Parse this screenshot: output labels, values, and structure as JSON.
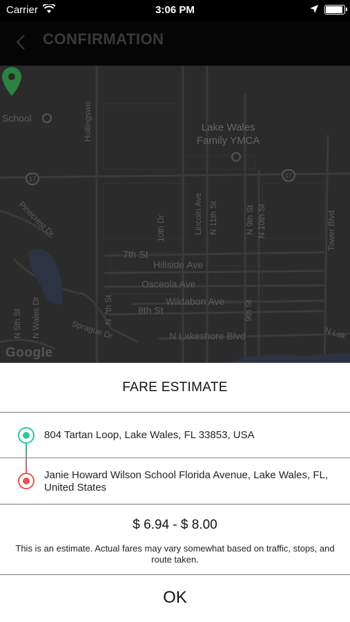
{
  "status_bar": {
    "carrier": "Carrier",
    "time": "3:06 PM",
    "battery_level": 0.95
  },
  "nav": {
    "title": "CONFIRMATION"
  },
  "map": {
    "labels": {
      "school": "School",
      "ymca": "Lake Wales\nFamily YMCA",
      "hollingsworth": "Hollingswo",
      "n10th": "N 10th St",
      "n9th_top": "N 9th St",
      "lincoln": "Lincoln Ave",
      "n11th": "N 11th St",
      "tower": "Tower Blvd",
      "tenth_dr": "10th Dr",
      "pinecrest": "Pinecrest Dr",
      "seventh": "7th St",
      "hillside": "Hillside Ave",
      "osceola": "Osceola Ave",
      "eighth": "8th St",
      "wildabon": "Wildabon Ave",
      "n7th": "N 7th St",
      "ninth": "9th St",
      "n5th": "N 5th St",
      "n_wales": "N Wales Dr",
      "sprague": "Sprague Dr",
      "lakeshore": "N Lakeshore Blvd",
      "n_lake": "N Lak",
      "route_17": "17",
      "google": "Google"
    },
    "accent_pin": "#2e9e4a"
  },
  "fare_sheet": {
    "title": "FARE ESTIMATE",
    "pickup": "804 Tartan Loop, Lake Wales, FL 33853, USA",
    "dropoff": "Janie Howard Wilson School Florida Avenue, Lake Wales, FL, United States",
    "fare_range": "$ 6.94 - $ 8.00",
    "note": "This is an estimate. Actual fares may vary somewhat based on traffic, stops, and route taken.",
    "ok_label": "OK",
    "pickup_color": "#2ec4a0",
    "dropoff_color": "#e8554e"
  }
}
